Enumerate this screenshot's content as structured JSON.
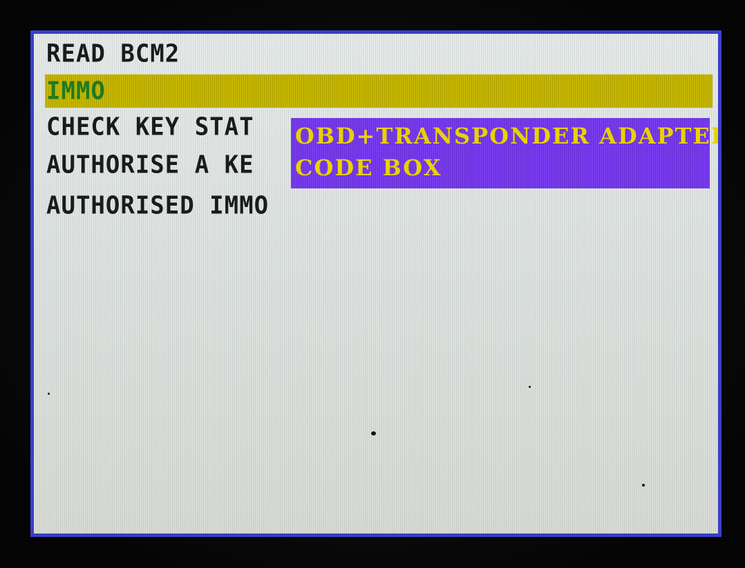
{
  "menu": {
    "items": [
      {
        "label": "READ BCM2"
      },
      {
        "label": "IMMO",
        "selected": true
      },
      {
        "label": "CHECK KEY STAT"
      },
      {
        "label": "AUTHORISE A KE"
      },
      {
        "label": "AUTHORISED IMMO"
      }
    ]
  },
  "popup": {
    "options": [
      {
        "label": "OBD+TRANSPONDER ADAPTER"
      },
      {
        "label": "CODE BOX"
      }
    ]
  },
  "colors": {
    "screen_border": "#3b3fc9",
    "screen_background": "#e2e6e3",
    "highlight_bar": "#c8b800",
    "highlight_text": "#1f7a1f",
    "menu_text": "#1b1b1b",
    "popup_background": "#7a3df0",
    "popup_text": "#e8d200"
  }
}
